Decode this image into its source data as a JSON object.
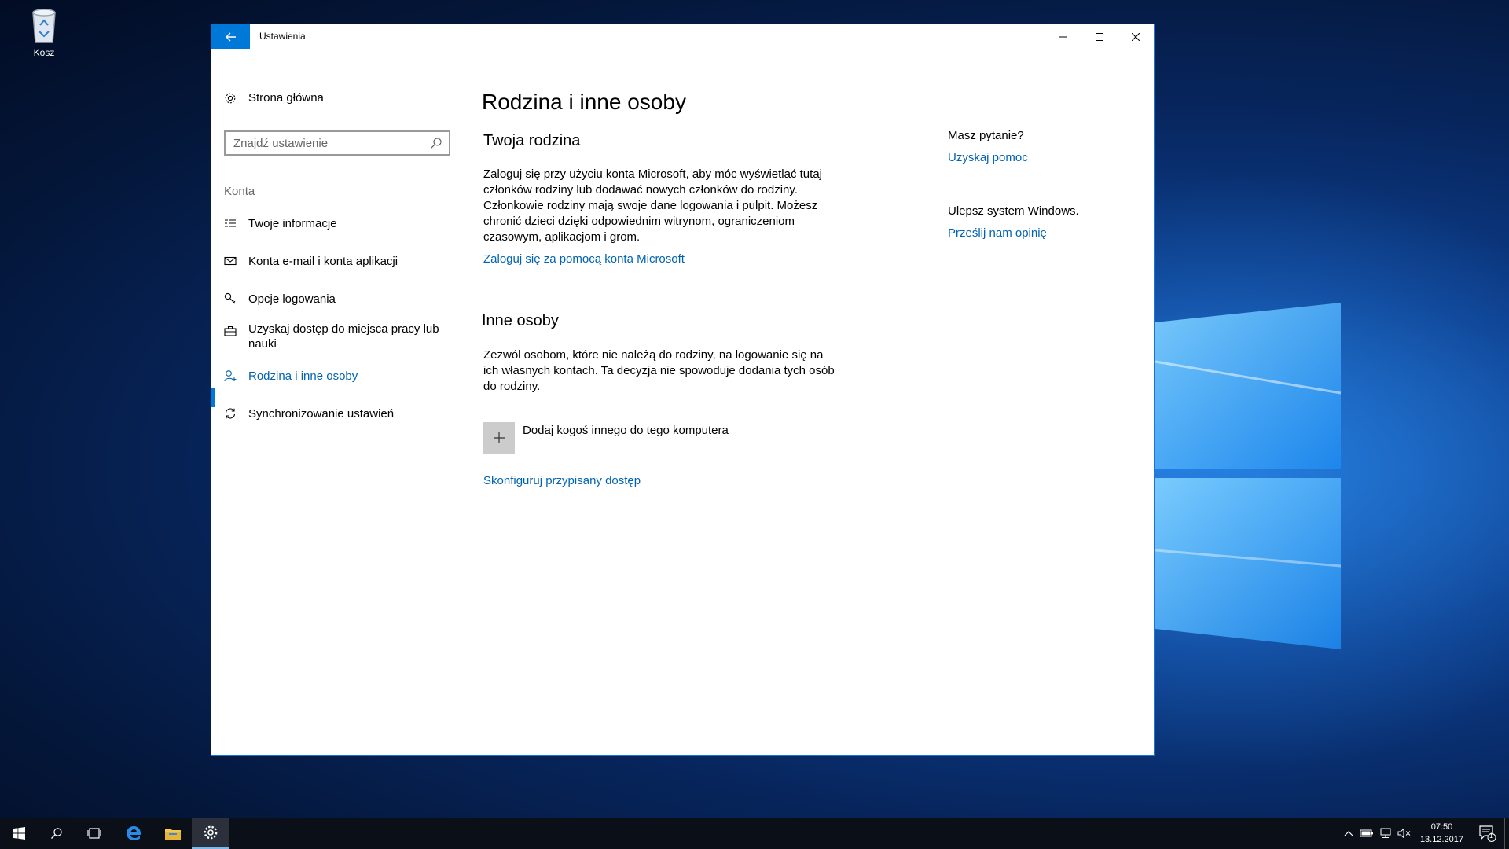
{
  "desktop": {
    "recycle_bin_label": "Kosz"
  },
  "window": {
    "title": "Ustawienia",
    "controls": [
      "minimize",
      "maximize",
      "close"
    ]
  },
  "nav": {
    "home_label": "Strona główna",
    "search_placeholder": "Znajdź ustawienie",
    "section_label": "Konta",
    "items": [
      {
        "label": "Twoje informacje",
        "icon": "person-info-icon"
      },
      {
        "label": "Konta e-mail i konta aplikacji",
        "icon": "mail-icon"
      },
      {
        "label": "Opcje logowania",
        "icon": "key-icon"
      },
      {
        "label": "Uzyskaj dostęp do miejsca pracy lub nauki",
        "icon": "briefcase-icon"
      },
      {
        "label": "Rodzina i inne osoby",
        "icon": "person-add-icon",
        "active": true
      },
      {
        "label": "Synchronizowanie ustawień",
        "icon": "sync-icon"
      }
    ]
  },
  "main": {
    "page_title": "Rodzina i inne osoby",
    "family": {
      "heading": "Twoja rodzina",
      "description": "Zaloguj się przy użyciu konta Microsoft, aby móc wyświetlać tutaj członków rodziny lub dodawać nowych członków do rodziny. Członkowie rodziny mają swoje dane logowania i pulpit. Możesz chronić dzieci dzięki odpowiednim witrynom, ograniczeniom czasowym, aplikacjom i grom.",
      "link": "Zaloguj się za pomocą konta Microsoft"
    },
    "others": {
      "heading": "Inne osoby",
      "description": "Zezwól osobom, które nie należą do rodziny, na logowanie się na ich własnych kontach. Ta decyzja nie spowoduje dodania tych osób do rodziny.",
      "add_label": "Dodaj kogoś innego do tego komputera",
      "assigned_access_link": "Skonfiguruj przypisany dostęp"
    }
  },
  "sidebar": {
    "question": "Masz pytanie?",
    "help_link": "Uzyskaj pomoc",
    "improve": "Ulepsz system Windows.",
    "feedback_link": "Prześlij nam opinię"
  },
  "taskbar": {
    "time": "07:50",
    "date": "13.12.2017",
    "notification_count": "1",
    "accent": "#76b9ed"
  }
}
